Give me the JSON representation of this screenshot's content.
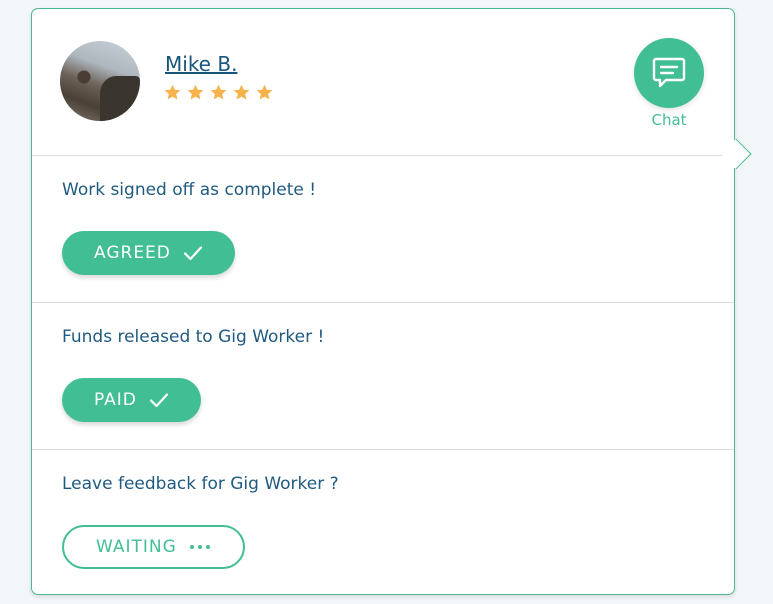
{
  "user": {
    "name": "Mike B.",
    "rating": 5,
    "rating_max": 5
  },
  "chat": {
    "label": "Chat",
    "icon": "chat-bubble-icon"
  },
  "steps": [
    {
      "message": "Work signed off as complete !",
      "status": "AGREED",
      "status_icon": "check-icon"
    },
    {
      "message": "Funds released to Gig Worker !",
      "status": "PAID",
      "status_icon": "check-icon"
    },
    {
      "message": "Leave feedback for Gig Worker ?",
      "status": "WAITING",
      "status_icon": "ellipsis-icon"
    }
  ],
  "colors": {
    "accent": "#41be94",
    "text": "#1f5a80",
    "star": "#f6b34b",
    "divider": "#d8dde2"
  }
}
